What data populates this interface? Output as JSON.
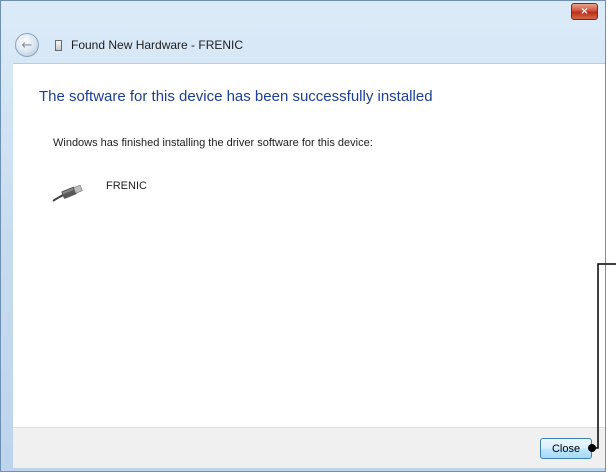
{
  "window": {
    "title": "Found New Hardware - FRENIC",
    "close_glyph": "×"
  },
  "content": {
    "heading": "The software for this device has been successfully installed",
    "body_text": "Windows has finished installing the driver software for this device:",
    "device": {
      "name": "FRENIC",
      "icon": "usb-cable-icon"
    }
  },
  "footer": {
    "close_button_label": "Close"
  },
  "icons": {
    "back": "back-arrow-icon",
    "dialog": "hardware-icon"
  },
  "colors": {
    "heading": "#1c3f95",
    "close_button_border": "#3c7fb1",
    "title_close": "#c9432b"
  }
}
